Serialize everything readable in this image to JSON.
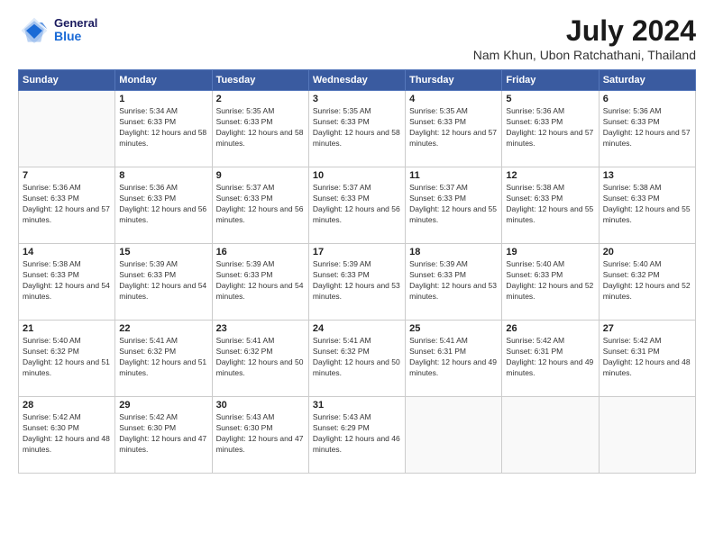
{
  "header": {
    "logo": {
      "general": "General",
      "blue": "Blue"
    },
    "title": "July 2024",
    "location": "Nam Khun, Ubon Ratchathani, Thailand"
  },
  "calendar": {
    "days_of_week": [
      "Sunday",
      "Monday",
      "Tuesday",
      "Wednesday",
      "Thursday",
      "Friday",
      "Saturday"
    ],
    "weeks": [
      [
        {
          "day": "",
          "sunrise": "",
          "sunset": "",
          "daylight": ""
        },
        {
          "day": "1",
          "sunrise": "Sunrise: 5:34 AM",
          "sunset": "Sunset: 6:33 PM",
          "daylight": "Daylight: 12 hours and 58 minutes."
        },
        {
          "day": "2",
          "sunrise": "Sunrise: 5:35 AM",
          "sunset": "Sunset: 6:33 PM",
          "daylight": "Daylight: 12 hours and 58 minutes."
        },
        {
          "day": "3",
          "sunrise": "Sunrise: 5:35 AM",
          "sunset": "Sunset: 6:33 PM",
          "daylight": "Daylight: 12 hours and 58 minutes."
        },
        {
          "day": "4",
          "sunrise": "Sunrise: 5:35 AM",
          "sunset": "Sunset: 6:33 PM",
          "daylight": "Daylight: 12 hours and 57 minutes."
        },
        {
          "day": "5",
          "sunrise": "Sunrise: 5:36 AM",
          "sunset": "Sunset: 6:33 PM",
          "daylight": "Daylight: 12 hours and 57 minutes."
        },
        {
          "day": "6",
          "sunrise": "Sunrise: 5:36 AM",
          "sunset": "Sunset: 6:33 PM",
          "daylight": "Daylight: 12 hours and 57 minutes."
        }
      ],
      [
        {
          "day": "7",
          "sunrise": "Sunrise: 5:36 AM",
          "sunset": "Sunset: 6:33 PM",
          "daylight": "Daylight: 12 hours and 57 minutes."
        },
        {
          "day": "8",
          "sunrise": "Sunrise: 5:36 AM",
          "sunset": "Sunset: 6:33 PM",
          "daylight": "Daylight: 12 hours and 56 minutes."
        },
        {
          "day": "9",
          "sunrise": "Sunrise: 5:37 AM",
          "sunset": "Sunset: 6:33 PM",
          "daylight": "Daylight: 12 hours and 56 minutes."
        },
        {
          "day": "10",
          "sunrise": "Sunrise: 5:37 AM",
          "sunset": "Sunset: 6:33 PM",
          "daylight": "Daylight: 12 hours and 56 minutes."
        },
        {
          "day": "11",
          "sunrise": "Sunrise: 5:37 AM",
          "sunset": "Sunset: 6:33 PM",
          "daylight": "Daylight: 12 hours and 55 minutes."
        },
        {
          "day": "12",
          "sunrise": "Sunrise: 5:38 AM",
          "sunset": "Sunset: 6:33 PM",
          "daylight": "Daylight: 12 hours and 55 minutes."
        },
        {
          "day": "13",
          "sunrise": "Sunrise: 5:38 AM",
          "sunset": "Sunset: 6:33 PM",
          "daylight": "Daylight: 12 hours and 55 minutes."
        }
      ],
      [
        {
          "day": "14",
          "sunrise": "Sunrise: 5:38 AM",
          "sunset": "Sunset: 6:33 PM",
          "daylight": "Daylight: 12 hours and 54 minutes."
        },
        {
          "day": "15",
          "sunrise": "Sunrise: 5:39 AM",
          "sunset": "Sunset: 6:33 PM",
          "daylight": "Daylight: 12 hours and 54 minutes."
        },
        {
          "day": "16",
          "sunrise": "Sunrise: 5:39 AM",
          "sunset": "Sunset: 6:33 PM",
          "daylight": "Daylight: 12 hours and 54 minutes."
        },
        {
          "day": "17",
          "sunrise": "Sunrise: 5:39 AM",
          "sunset": "Sunset: 6:33 PM",
          "daylight": "Daylight: 12 hours and 53 minutes."
        },
        {
          "day": "18",
          "sunrise": "Sunrise: 5:39 AM",
          "sunset": "Sunset: 6:33 PM",
          "daylight": "Daylight: 12 hours and 53 minutes."
        },
        {
          "day": "19",
          "sunrise": "Sunrise: 5:40 AM",
          "sunset": "Sunset: 6:33 PM",
          "daylight": "Daylight: 12 hours and 52 minutes."
        },
        {
          "day": "20",
          "sunrise": "Sunrise: 5:40 AM",
          "sunset": "Sunset: 6:32 PM",
          "daylight": "Daylight: 12 hours and 52 minutes."
        }
      ],
      [
        {
          "day": "21",
          "sunrise": "Sunrise: 5:40 AM",
          "sunset": "Sunset: 6:32 PM",
          "daylight": "Daylight: 12 hours and 51 minutes."
        },
        {
          "day": "22",
          "sunrise": "Sunrise: 5:41 AM",
          "sunset": "Sunset: 6:32 PM",
          "daylight": "Daylight: 12 hours and 51 minutes."
        },
        {
          "day": "23",
          "sunrise": "Sunrise: 5:41 AM",
          "sunset": "Sunset: 6:32 PM",
          "daylight": "Daylight: 12 hours and 50 minutes."
        },
        {
          "day": "24",
          "sunrise": "Sunrise: 5:41 AM",
          "sunset": "Sunset: 6:32 PM",
          "daylight": "Daylight: 12 hours and 50 minutes."
        },
        {
          "day": "25",
          "sunrise": "Sunrise: 5:41 AM",
          "sunset": "Sunset: 6:31 PM",
          "daylight": "Daylight: 12 hours and 49 minutes."
        },
        {
          "day": "26",
          "sunrise": "Sunrise: 5:42 AM",
          "sunset": "Sunset: 6:31 PM",
          "daylight": "Daylight: 12 hours and 49 minutes."
        },
        {
          "day": "27",
          "sunrise": "Sunrise: 5:42 AM",
          "sunset": "Sunset: 6:31 PM",
          "daylight": "Daylight: 12 hours and 48 minutes."
        }
      ],
      [
        {
          "day": "28",
          "sunrise": "Sunrise: 5:42 AM",
          "sunset": "Sunset: 6:30 PM",
          "daylight": "Daylight: 12 hours and 48 minutes."
        },
        {
          "day": "29",
          "sunrise": "Sunrise: 5:42 AM",
          "sunset": "Sunset: 6:30 PM",
          "daylight": "Daylight: 12 hours and 47 minutes."
        },
        {
          "day": "30",
          "sunrise": "Sunrise: 5:43 AM",
          "sunset": "Sunset: 6:30 PM",
          "daylight": "Daylight: 12 hours and 47 minutes."
        },
        {
          "day": "31",
          "sunrise": "Sunrise: 5:43 AM",
          "sunset": "Sunset: 6:29 PM",
          "daylight": "Daylight: 12 hours and 46 minutes."
        },
        {
          "day": "",
          "sunrise": "",
          "sunset": "",
          "daylight": ""
        },
        {
          "day": "",
          "sunrise": "",
          "sunset": "",
          "daylight": ""
        },
        {
          "day": "",
          "sunrise": "",
          "sunset": "",
          "daylight": ""
        }
      ]
    ]
  }
}
